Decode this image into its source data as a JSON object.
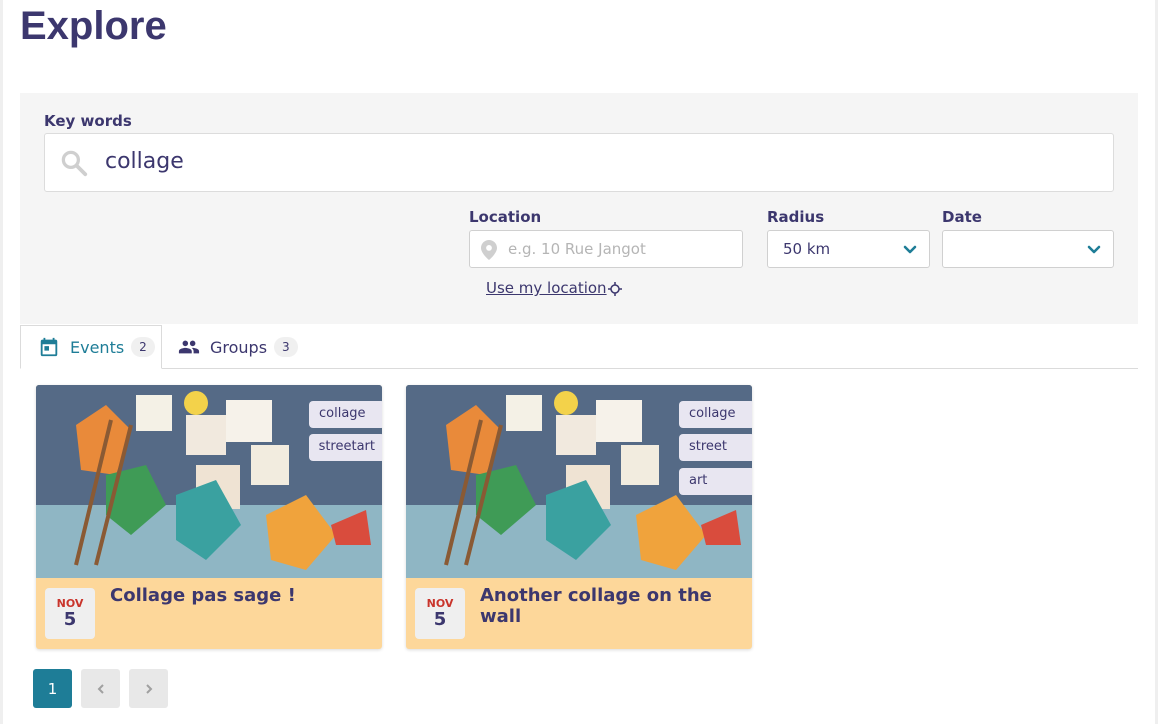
{
  "page": {
    "title": "Explore"
  },
  "search": {
    "keywords_label": "Key words",
    "keywords_value": "collage",
    "location_label": "Location",
    "location_placeholder": "e.g. 10 Rue Jangot",
    "radius_label": "Radius",
    "radius_value": "50 km",
    "date_label": "Date",
    "date_value": "",
    "use_location_label": "Use my location"
  },
  "tabs": [
    {
      "label": "Events",
      "count": "2",
      "icon": "calendar-icon",
      "active": true
    },
    {
      "label": "Groups",
      "count": "3",
      "icon": "groups-icon",
      "active": false
    }
  ],
  "events": [
    {
      "title": "Collage pas sage !",
      "month": "NOV",
      "day": "5",
      "tags": [
        "collage",
        "streetart"
      ]
    },
    {
      "title": "Another collage on the wall",
      "month": "NOV",
      "day": "5",
      "tags": [
        "collage",
        "street",
        "art"
      ]
    }
  ],
  "pagination": {
    "current": "1"
  },
  "colors": {
    "primary": "#3c376e",
    "accent": "#1e7d97",
    "card_bg": "#fdd79a",
    "month": "#c9342b"
  }
}
